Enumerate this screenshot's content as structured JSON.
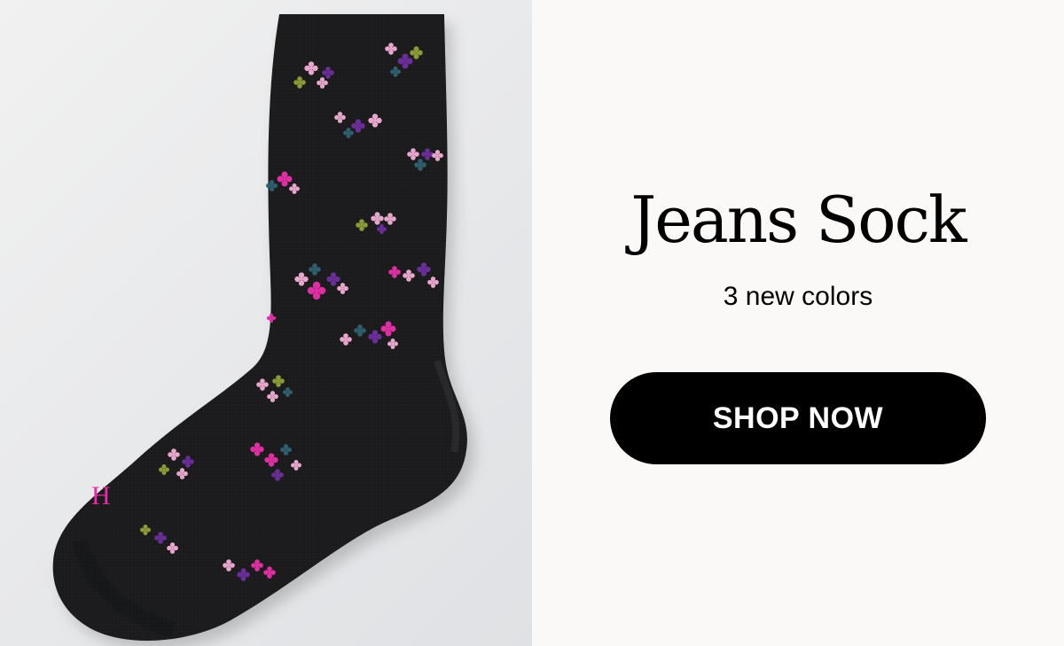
{
  "product": {
    "title": "Jeans Sock",
    "subtitle": "3 new colors",
    "image_alt": "Black floral jeans sock",
    "logo_mark": "H"
  },
  "cta": {
    "label": "SHOP NOW"
  },
  "colors": {
    "page_background": "#fbf9f7",
    "image_background": "#e8e9eb",
    "sock": "#1b1c1f",
    "button": "#000000",
    "button_text": "#ffffff",
    "accent_pink": "#e02fa3",
    "flower_light_pink": "#e7a7cc",
    "flower_purple": "#6b2e99",
    "flower_teal": "#2f5f6e",
    "flower_olive": "#8d9a36"
  }
}
